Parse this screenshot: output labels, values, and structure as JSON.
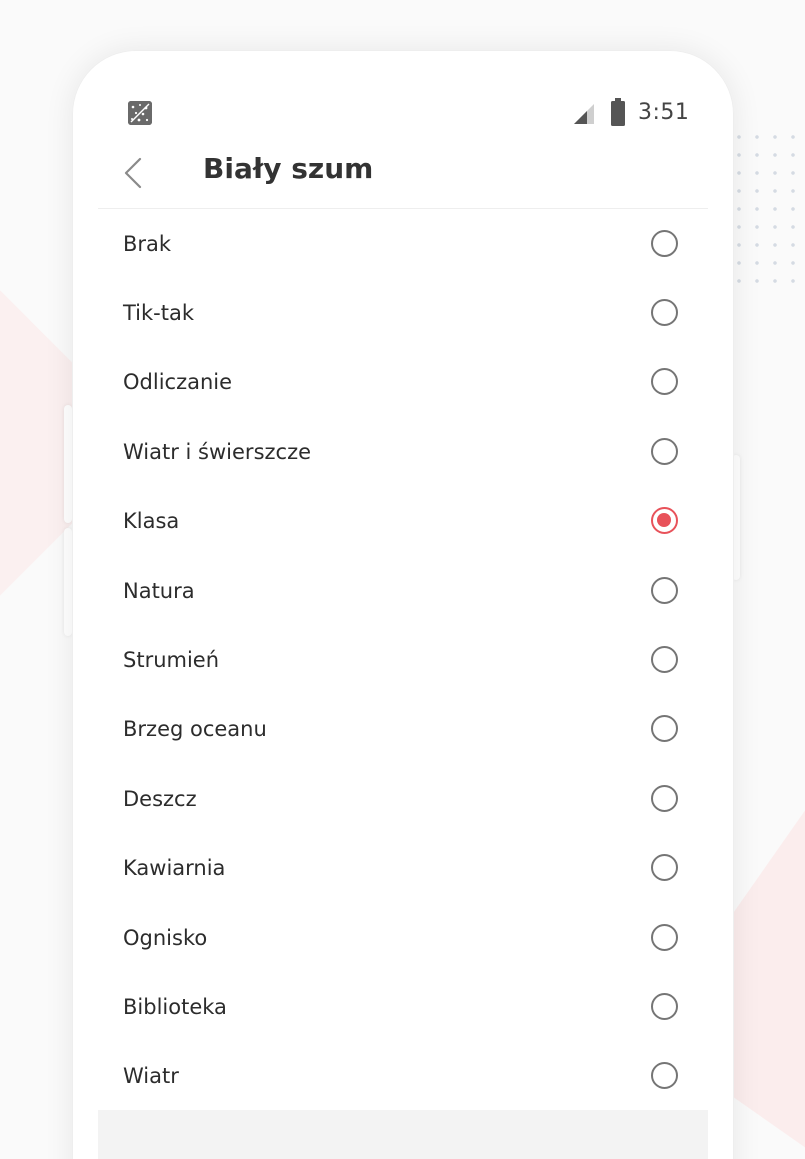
{
  "status_bar": {
    "app_icon": "sleep-app-icon",
    "signal_icon": "cell-signal-icon",
    "battery_icon": "battery-icon",
    "time": "3:51"
  },
  "header": {
    "back_icon": "chevron-left-icon",
    "title": "Biały szum"
  },
  "colors": {
    "accent": "#e8525a",
    "text": "#2c2c2c",
    "radio_unchecked": "#757575"
  },
  "options": [
    {
      "label": "Brak",
      "selected": false
    },
    {
      "label": "Tik-tak",
      "selected": false
    },
    {
      "label": "Odliczanie",
      "selected": false
    },
    {
      "label": "Wiatr i świerszcze",
      "selected": false
    },
    {
      "label": "Klasa",
      "selected": true
    },
    {
      "label": "Natura",
      "selected": false
    },
    {
      "label": "Strumień",
      "selected": false
    },
    {
      "label": "Brzeg oceanu",
      "selected": false
    },
    {
      "label": "Deszcz",
      "selected": false
    },
    {
      "label": "Kawiarnia",
      "selected": false
    },
    {
      "label": "Ognisko",
      "selected": false
    },
    {
      "label": "Biblioteka",
      "selected": false
    },
    {
      "label": "Wiatr",
      "selected": false
    }
  ]
}
